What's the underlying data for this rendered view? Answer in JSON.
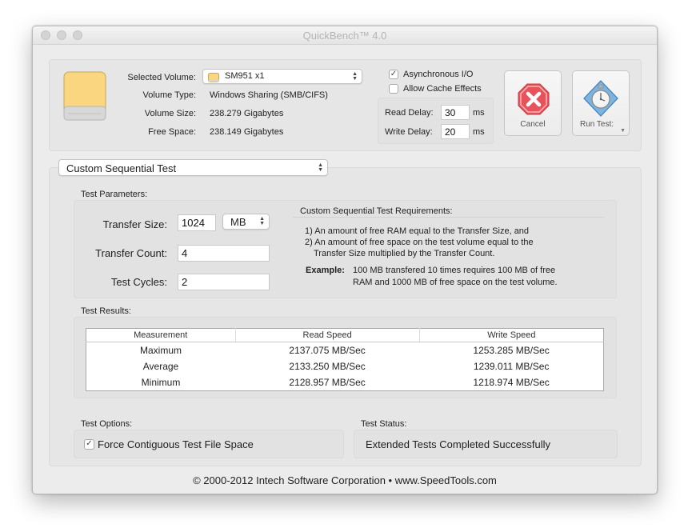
{
  "window": {
    "title": "QuickBench™ 4.0"
  },
  "volume": {
    "selected_label": "Selected Volume:",
    "selected_value": "SM951 x1",
    "type_label": "Volume Type:",
    "type_value": "Windows Sharing (SMB/CIFS)",
    "size_label": "Volume Size:",
    "size_value": "238.279 Gigabytes",
    "free_label": "Free Space:",
    "free_value": "238.149 Gigabytes"
  },
  "options_top": {
    "async_label": "Asynchronous I/O",
    "async_checked": true,
    "cache_label": "Allow Cache Effects",
    "cache_checked": false,
    "read_delay_label": "Read Delay:",
    "read_delay_value": "30",
    "read_delay_unit": "ms",
    "write_delay_label": "Write Delay:",
    "write_delay_value": "20",
    "write_delay_unit": "ms"
  },
  "buttons": {
    "cancel_label": "Cancel",
    "run_label": "Run Test:"
  },
  "test_selector": {
    "value": "Custom Sequential Test"
  },
  "parameters": {
    "heading": "Test Parameters:",
    "transfer_size_label": "Transfer Size:",
    "transfer_size_value": "1024",
    "transfer_size_unit": "MB",
    "transfer_count_label": "Transfer Count:",
    "transfer_count_value": "4",
    "test_cycles_label": "Test Cycles:",
    "test_cycles_value": "2"
  },
  "requirements": {
    "heading": "Custom Sequential Test Requirements:",
    "line1": "1) An amount of free RAM equal to the Transfer Size, and",
    "line2a": "2) An amount of free space on the test volume equal to the",
    "line2b": "Transfer Size multiplied by the Transfer Count.",
    "example_label": "Example:",
    "example_line1": "100 MB transfered 10 times requires 100 MB of free",
    "example_line2": "RAM and 1000 MB of free space on the test volume."
  },
  "results": {
    "heading": "Test Results:",
    "columns": [
      "Measurement",
      "Read Speed",
      "Write Speed"
    ],
    "rows": [
      [
        "Maximum",
        "2137.075 MB/Sec",
        "1253.285 MB/Sec"
      ],
      [
        "Average",
        "2133.250 MB/Sec",
        "1239.011 MB/Sec"
      ],
      [
        "Minimum",
        "2128.957 MB/Sec",
        "1218.974 MB/Sec"
      ]
    ]
  },
  "test_options": {
    "heading": "Test Options:",
    "force_label": "Force Contiguous Test File Space",
    "force_checked": true
  },
  "test_status": {
    "heading": "Test Status:",
    "value": "Extended Tests Completed Successfully"
  },
  "footer": {
    "copyright": "© 2000-2012 Intech Software Corporation • www.SpeedTools.com"
  },
  "colors": {
    "drive_icon": "#f9d67f",
    "cancel_octagon": "#e8525a",
    "window_bg": "#ececec"
  },
  "icons": [
    "drive-icon",
    "cancel-octagon-icon",
    "stopwatch-icon",
    "check-icon",
    "popup-arrows-icon"
  ]
}
